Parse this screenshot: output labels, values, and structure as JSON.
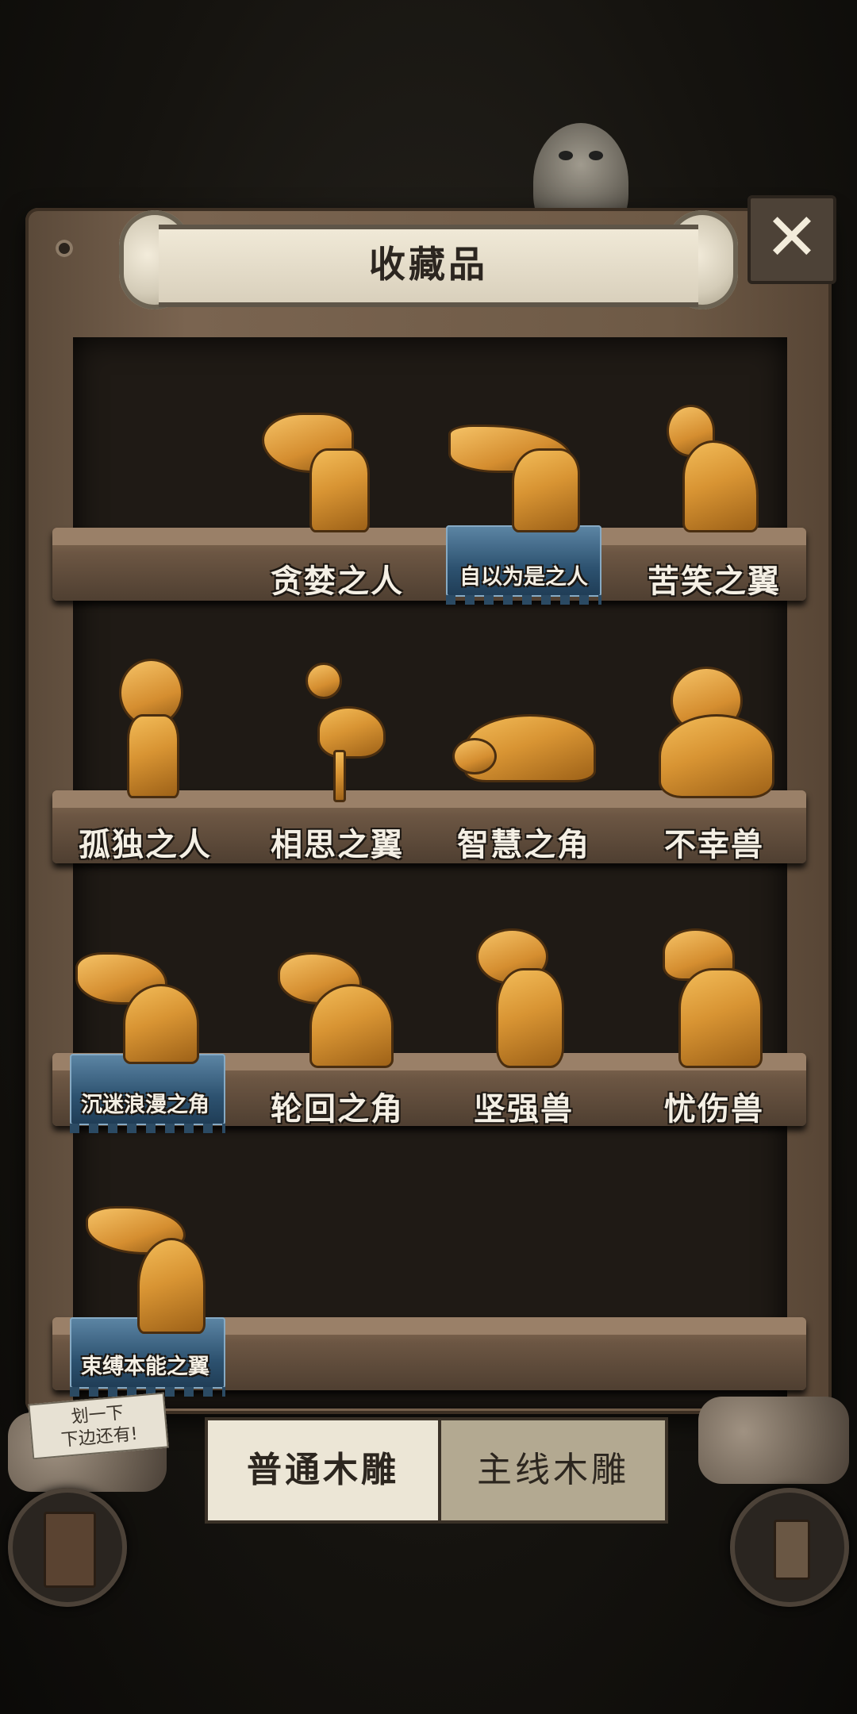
{
  "header": {
    "title": "收藏品"
  },
  "close_label": "✕",
  "shelves": [
    {
      "items": [
        {
          "name": "贪婪之人",
          "highlighted": false
        },
        {
          "name": "自以为是之人",
          "highlighted": true
        },
        {
          "name": "苦笑之翼",
          "highlighted": false
        }
      ]
    },
    {
      "items": [
        {
          "name": "孤独之人",
          "highlighted": false
        },
        {
          "name": "相思之翼",
          "highlighted": false
        },
        {
          "name": "智慧之角",
          "highlighted": false
        },
        {
          "name": "不幸兽",
          "highlighted": false
        }
      ]
    },
    {
      "items": [
        {
          "name": "沉迷浪漫之角",
          "highlighted": true
        },
        {
          "name": "轮回之角",
          "highlighted": false
        },
        {
          "name": "坚强兽",
          "highlighted": false
        },
        {
          "name": "忧伤兽",
          "highlighted": false
        }
      ]
    },
    {
      "items": [
        {
          "name": "束缚本能之翼",
          "highlighted": true
        }
      ]
    }
  ],
  "scroll_hint": {
    "line1": "划一下",
    "line2": "下边还有!"
  },
  "tabs": [
    {
      "label": "普通木雕",
      "active": true
    },
    {
      "label": "主线木雕",
      "active": false
    }
  ],
  "colors": {
    "wood": "#6e5a46",
    "figure": "#d89433",
    "highlight": "#2d5270",
    "parchment": "#ece6d6"
  }
}
